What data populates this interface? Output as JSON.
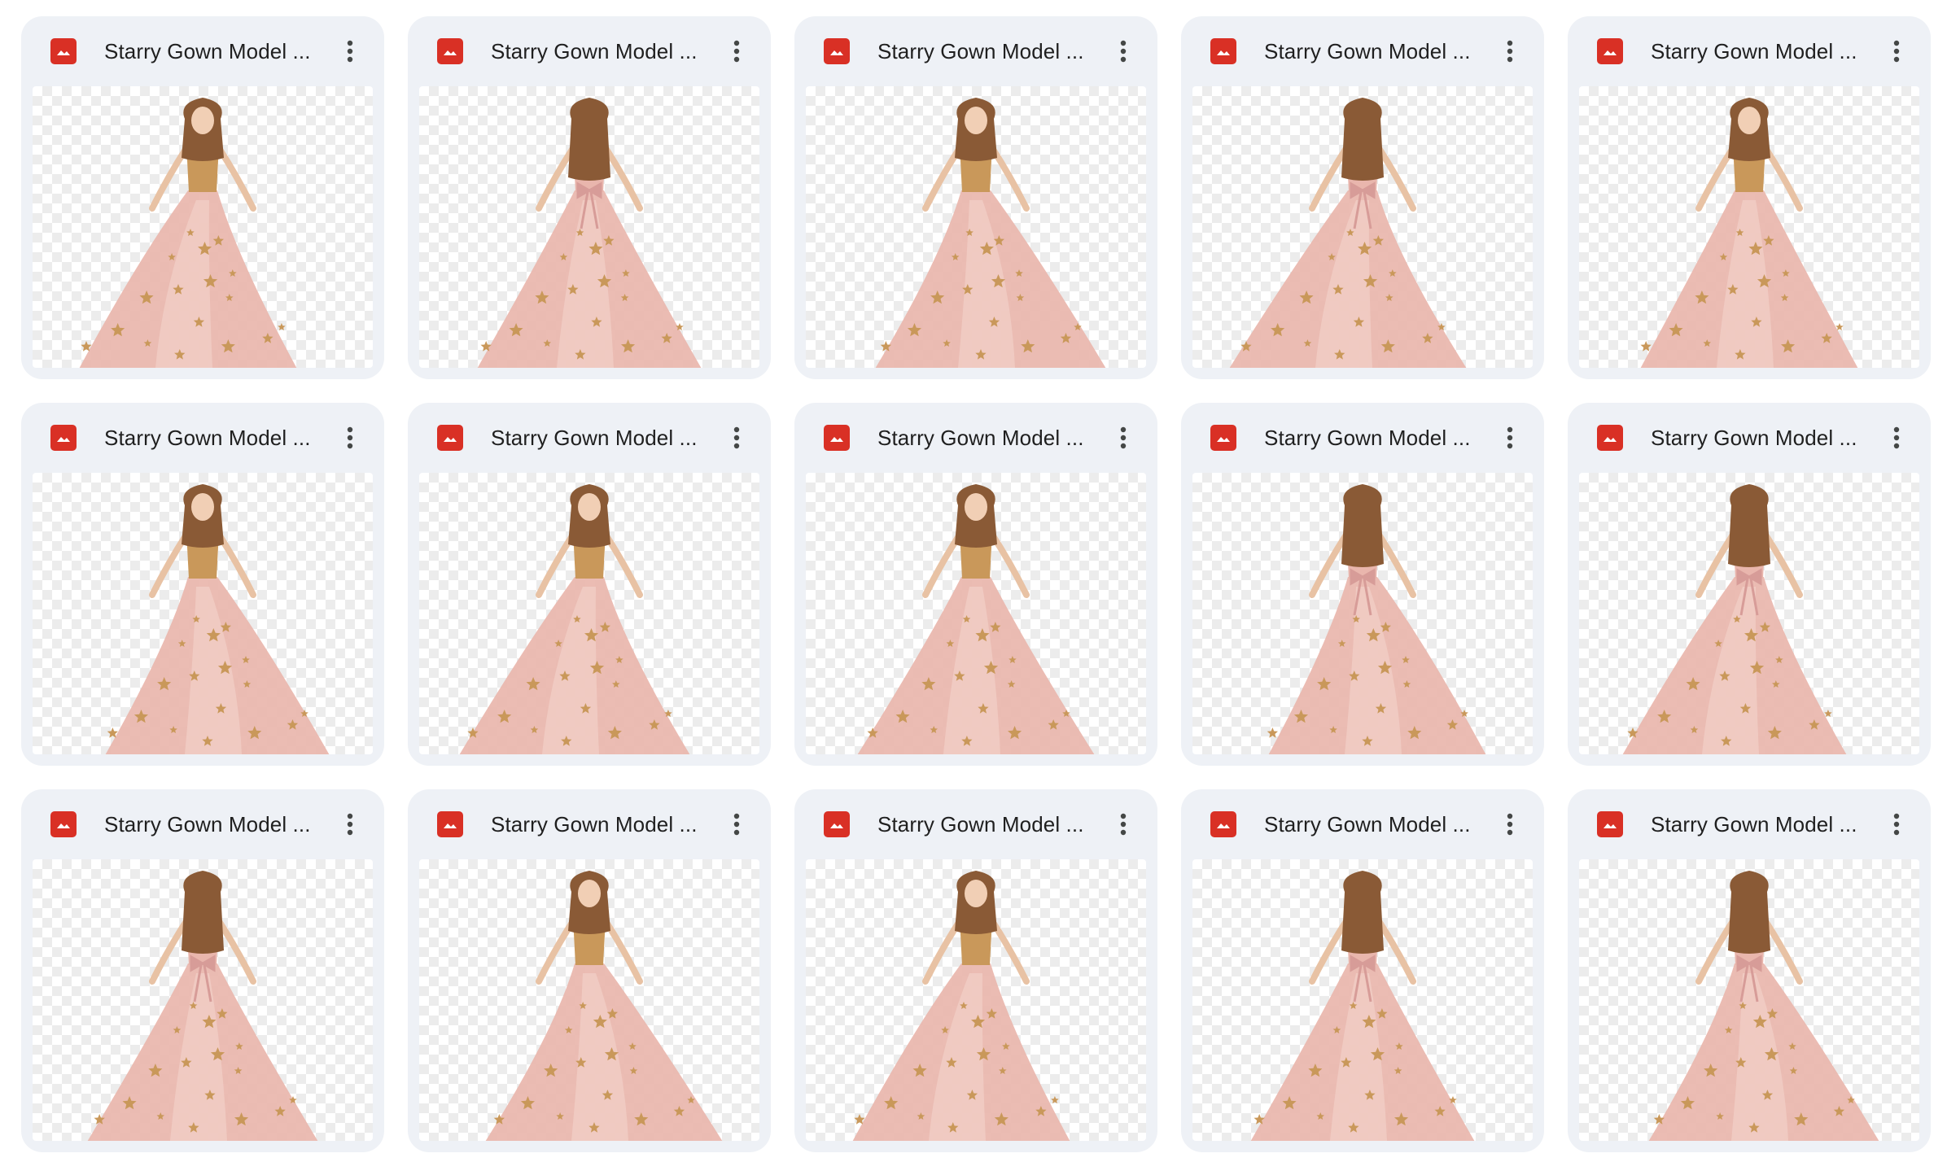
{
  "colors": {
    "card_background": "#eef1f6",
    "image_icon": "#d93025",
    "gown_pink": "#e9b6ad",
    "gown_gold": "#c9985a",
    "hair_brown": "#8a5a36"
  },
  "file_type_icon": "image-icon",
  "menu_icon": "more-vertical-icon",
  "files": [
    {
      "name": "Starry Gown Model ...",
      "view": "front"
    },
    {
      "name": "Starry Gown Model ...",
      "view": "back"
    },
    {
      "name": "Starry Gown Model ...",
      "view": "front"
    },
    {
      "name": "Starry Gown Model ...",
      "view": "back"
    },
    {
      "name": "Starry Gown Model ...",
      "view": "front"
    },
    {
      "name": "Starry Gown Model ...",
      "view": "front"
    },
    {
      "name": "Starry Gown Model ...",
      "view": "front"
    },
    {
      "name": "Starry Gown Model ...",
      "view": "front"
    },
    {
      "name": "Starry Gown Model ...",
      "view": "back"
    },
    {
      "name": "Starry Gown Model ...",
      "view": "back"
    },
    {
      "name": "Starry Gown Model ...",
      "view": "back"
    },
    {
      "name": "Starry Gown Model ...",
      "view": "front"
    },
    {
      "name": "Starry Gown Model ...",
      "view": "front"
    },
    {
      "name": "Starry Gown Model ...",
      "view": "back"
    },
    {
      "name": "Starry Gown Model ...",
      "view": "back"
    }
  ]
}
